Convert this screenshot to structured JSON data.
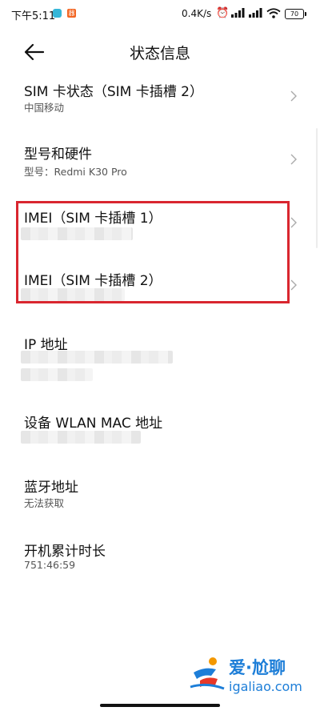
{
  "status_bar": {
    "time": "下午5:11",
    "app_badge": "器",
    "net_speed": "0.4K/s",
    "battery": "70"
  },
  "header": {
    "title": "状态信息"
  },
  "items": [
    {
      "title": "SIM 卡状态（SIM 卡插槽 2）",
      "subtitle": "中国移动"
    },
    {
      "title": "型号和硬件",
      "subtitle": "型号：Redmi K30 Pro"
    },
    {
      "title": "IMEI（SIM 卡插槽 1）",
      "subtitle": ""
    },
    {
      "title": "IMEI（SIM 卡插槽 2）",
      "subtitle": ""
    },
    {
      "title": "IP 地址",
      "subtitle": ""
    },
    {
      "title": "设备 WLAN MAC 地址",
      "subtitle": ""
    },
    {
      "title": "蓝牙地址",
      "subtitle": "无法获取"
    },
    {
      "title": "开机累计时长",
      "subtitle": "751:46:59"
    }
  ],
  "watermark": {
    "brand": "爱·尬聊",
    "url": "igaliao.com"
  },
  "colors": {
    "highlight": "#d9262f",
    "watermark": "#1d7ed8"
  }
}
